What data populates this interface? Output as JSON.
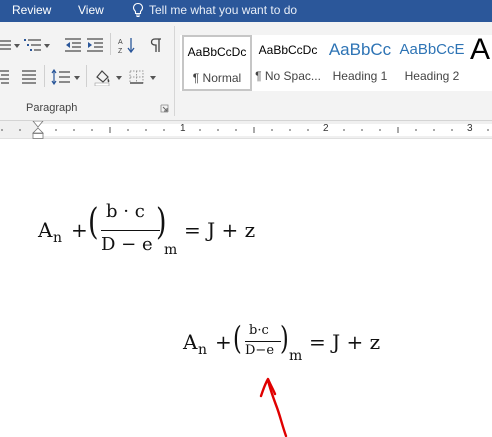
{
  "ribbon_tabs": {
    "review": "Review",
    "view": "View",
    "tell_me": "Tell me what you want to do"
  },
  "paragraph_group": {
    "label": "Paragraph",
    "icons": [
      "bullets-icon",
      "multilevel-list-icon",
      "decrease-indent-icon",
      "increase-indent-icon",
      "sort-icon",
      "show-formatting-marks-icon",
      "align-right-icon",
      "justify-icon",
      "line-spacing-icon",
      "shading-icon",
      "borders-icon",
      "dialog-launcher-icon"
    ]
  },
  "styles": [
    {
      "sample": "AaBbCcDc",
      "name": "¶ Normal",
      "selected": true
    },
    {
      "sample": "AaBbCcDc",
      "name": "¶ No Spac..."
    },
    {
      "sample": "AaBbCc",
      "name": "Heading 1",
      "color": "#2e74b5"
    },
    {
      "sample": "AaBbCcE",
      "name": "Heading 2",
      "color": "#2e74b5"
    },
    {
      "sample": "A",
      "name": ""
    }
  ],
  "ruler": {
    "numbers": [
      "1",
      "2",
      "3"
    ]
  },
  "equation_1": {
    "A": "A",
    "n": "n",
    "plus": "+",
    "lparen": "(",
    "numerator": "b · c",
    "denominator": "D − e",
    "rparen": ")",
    "m": "m",
    "rhs": "= J + z"
  },
  "equation_2": {
    "A": "A",
    "n": "n",
    "plus": "+",
    "lparen": "(",
    "numerator": "b·c",
    "denominator": "D−e",
    "rparen": ")",
    "m": "m",
    "rhs": "= J + z"
  },
  "colors": {
    "ribbon_tab_bar": "#2b579a",
    "heading_style": "#2e74b5",
    "annotation_arrow": "#e00000"
  }
}
